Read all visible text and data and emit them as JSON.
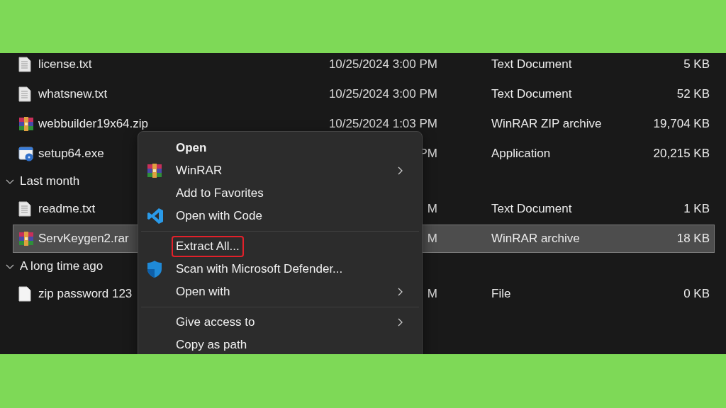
{
  "sections": [
    {
      "files": [
        {
          "name": "license.txt",
          "date": "10/25/2024 3:00 PM",
          "type": "Text Document",
          "size": "5 KB",
          "kind": "text",
          "selected": false
        },
        {
          "name": "whatsnew.txt",
          "date": "10/25/2024 3:00 PM",
          "type": "Text Document",
          "size": "52 KB",
          "kind": "text",
          "selected": false
        },
        {
          "name": "webbuilder19x64.zip",
          "date": "10/25/2024 1:03 PM",
          "type": "WinRAR ZIP archive",
          "size": "19,704 KB",
          "kind": "archive",
          "selected": false
        },
        {
          "name": "setup64.exe",
          "date": "PM",
          "type": "Application",
          "size": "20,215 KB",
          "kind": "exe",
          "selected": false
        }
      ]
    },
    {
      "label": "Last month",
      "expanded": true,
      "files": [
        {
          "name": "readme.txt",
          "date": "M",
          "type": "Text Document",
          "size": "1 KB",
          "kind": "text",
          "selected": false
        },
        {
          "name": "ServKeygen2.rar",
          "date": "M",
          "type": "WinRAR archive",
          "size": "18 KB",
          "kind": "archive",
          "selected": true
        }
      ]
    },
    {
      "label": "A long time ago",
      "expanded": true,
      "files": [
        {
          "name": "zip password 123",
          "date": "M",
          "type": "File",
          "size": "0 KB",
          "kind": "blank",
          "selected": false
        }
      ]
    }
  ],
  "context_menu": [
    {
      "kind": "plain",
      "label": "Open",
      "default": true
    },
    {
      "kind": "archive",
      "label": "WinRAR",
      "submenu": true
    },
    {
      "kind": "plain",
      "label": "Add to Favorites"
    },
    {
      "kind": "code",
      "label": "Open with Code"
    },
    {
      "kind": "separator"
    },
    {
      "kind": "plain",
      "label": "Extract All...",
      "highlighted": true
    },
    {
      "kind": "shield",
      "label": "Scan with Microsoft Defender..."
    },
    {
      "kind": "plain",
      "label": "Open with",
      "submenu": true
    },
    {
      "kind": "separator"
    },
    {
      "kind": "plain",
      "label": "Give access to",
      "submenu": true
    },
    {
      "kind": "plain",
      "label": "Copy as path"
    }
  ]
}
